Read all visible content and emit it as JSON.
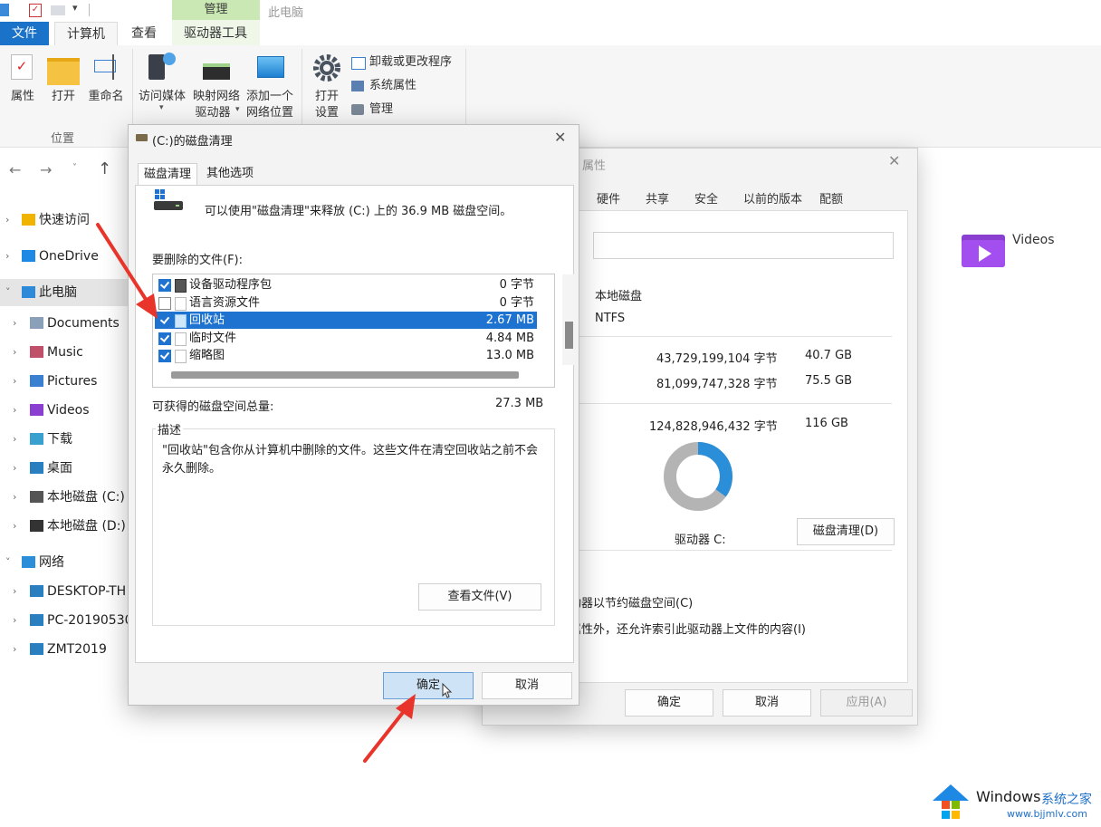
{
  "explorer": {
    "context_tab": "管理",
    "window_title": "此电脑",
    "tabs": {
      "file": "文件",
      "computer": "计算机",
      "view": "查看",
      "drive_tools": "驱动器工具"
    },
    "ribbon": {
      "properties": "属性",
      "open": "打开",
      "rename": "重命名",
      "access_media": "访问媒体",
      "map_drive_1": "映射网络",
      "map_drive_2": "驱动器",
      "add_location_1": "添加一个",
      "add_location_2": "网络位置",
      "open_settings_1": "打开",
      "open_settings_2": "设置",
      "uninstall": "卸载或更改程序",
      "system_props": "系统属性",
      "manage": "管理",
      "group_location": "位置"
    },
    "nav": [
      {
        "label": "快速访问",
        "icon": "star-icon"
      },
      {
        "label": "OneDrive",
        "icon": "cloud-icon"
      },
      {
        "label": "此电脑",
        "icon": "computer-icon"
      },
      {
        "label": "Documents",
        "icon": "folder-icon"
      },
      {
        "label": "Music",
        "icon": "music-folder-icon"
      },
      {
        "label": "Pictures",
        "icon": "pictures-folder-icon"
      },
      {
        "label": "Videos",
        "icon": "videos-folder-icon"
      },
      {
        "label": "下载",
        "icon": "download-folder-icon"
      },
      {
        "label": "桌面",
        "icon": "desktop-folder-icon"
      },
      {
        "label": "本地磁盘 (C:)",
        "icon": "drive-icon"
      },
      {
        "label": "本地磁盘 (D:)",
        "icon": "drive-icon"
      },
      {
        "label": "网络",
        "icon": "network-icon"
      },
      {
        "label": "DESKTOP-TH",
        "icon": "monitor-icon"
      },
      {
        "label": "PC-20190530",
        "icon": "monitor-icon"
      },
      {
        "label": "ZMT2019",
        "icon": "monitor-icon"
      }
    ],
    "content_folder": "Videos"
  },
  "properties_dialog": {
    "title": "属性",
    "tabs": [
      "硬件",
      "共享",
      "安全",
      "以前的版本",
      "配额"
    ],
    "type_value": "本地磁盘",
    "fs_value": "NTFS",
    "used_label_tail": ":",
    "used_bytes": "43,729,199,104 字节",
    "used_gb": "40.7 GB",
    "free_label_tail": ":",
    "free_bytes": "81,099,747,328 字节",
    "free_gb": "75.5 GB",
    "capacity_bytes": "124,828,946,432 字节",
    "capacity_gb": "116 GB",
    "drive_label": "驱动器 C:",
    "cleanup_button": "磁盘清理(D)",
    "compress_text": "动器以节约磁盘空间(C)",
    "index_text": "属性外，还允许索引此驱动器上文件的内容(I)",
    "ok": "确定",
    "cancel": "取消",
    "apply": "应用(A)",
    "used_fraction": 0.35,
    "colors": {
      "used": "#2a8fd8",
      "free": "#b4b4b4"
    }
  },
  "cleanup_dialog": {
    "title": "(C:)的磁盘清理",
    "tabs": {
      "cleanup": "磁盘清理",
      "more": "其他选项"
    },
    "intro": "可以使用\"磁盘清理\"来释放  (C:) 上的 36.9 MB 磁盘空间。",
    "files_label": "要删除的文件(F):",
    "files": [
      {
        "label": "设备驱动程序包",
        "size": "0 字节",
        "checked": true,
        "selected": false
      },
      {
        "label": "语言资源文件",
        "size": "0 字节",
        "checked": false,
        "selected": false
      },
      {
        "label": "回收站",
        "size": "2.67 MB",
        "checked": true,
        "selected": true
      },
      {
        "label": "临时文件",
        "size": "4.84 MB",
        "checked": true,
        "selected": false
      },
      {
        "label": "缩略图",
        "size": "13.0 MB",
        "checked": true,
        "selected": false
      }
    ],
    "total_label": "可获得的磁盘空间总量:",
    "total_value": "27.3 MB",
    "desc_label": "描述",
    "desc_text": "\"回收站\"包含你从计算机中删除的文件。这些文件在清空回收站之前不会永久删除。",
    "view_files": "查看文件(V)",
    "ok": "确定",
    "cancel": "取消"
  },
  "watermark": {
    "brand": "Windows",
    "site_cn": "系统之家",
    "url": "www.bjjmlv.com"
  }
}
